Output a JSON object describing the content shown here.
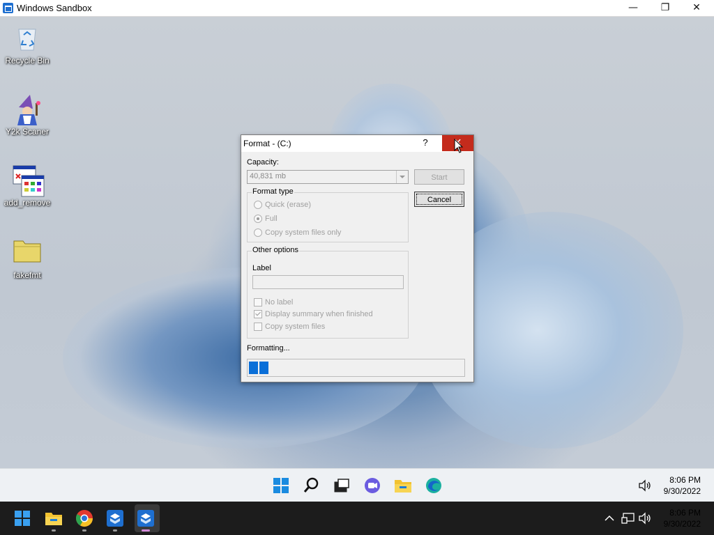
{
  "window": {
    "title": "Windows Sandbox",
    "minimize": "—",
    "restore": "❐",
    "close": "✕"
  },
  "desktop_icons": [
    {
      "label": "Recycle Bin"
    },
    {
      "label": "Y2k Scaner"
    },
    {
      "label": "add_remove"
    },
    {
      "label": "fakefmt"
    }
  ],
  "dialog": {
    "title": "Format -  (C:)",
    "help": "?",
    "close": "✕",
    "capacity_label": "Capacity:",
    "capacity_value": "40,831 mb",
    "start_button": "Start",
    "cancel_button": "Cancel",
    "format_type_label": "Format type",
    "format_options": [
      "Quick (erase)",
      "Full",
      "Copy system files only"
    ],
    "selected_format": "Full",
    "other_options_label": "Other options",
    "label_label": "Label",
    "label_value": "",
    "checkboxes": [
      {
        "label": "No label",
        "checked": false
      },
      {
        "label": "Display summary when finished",
        "checked": true
      },
      {
        "label": "Copy system files",
        "checked": false
      }
    ],
    "status_text": "Formatting...",
    "progress_blocks": 2
  },
  "inner_taskbar": {
    "icons": [
      "start-icon",
      "search-icon",
      "task-view-icon",
      "chat-icon",
      "file-explorer-icon",
      "edge-icon"
    ],
    "time": "8:06 PM",
    "date": "9/30/2022"
  },
  "host_taskbar": {
    "icons": [
      "start-icon",
      "file-explorer-icon",
      "chrome-icon",
      "sandbox-icon",
      "sandbox-active-icon"
    ],
    "time": "8:06 PM",
    "date": "9/30/2022"
  }
}
